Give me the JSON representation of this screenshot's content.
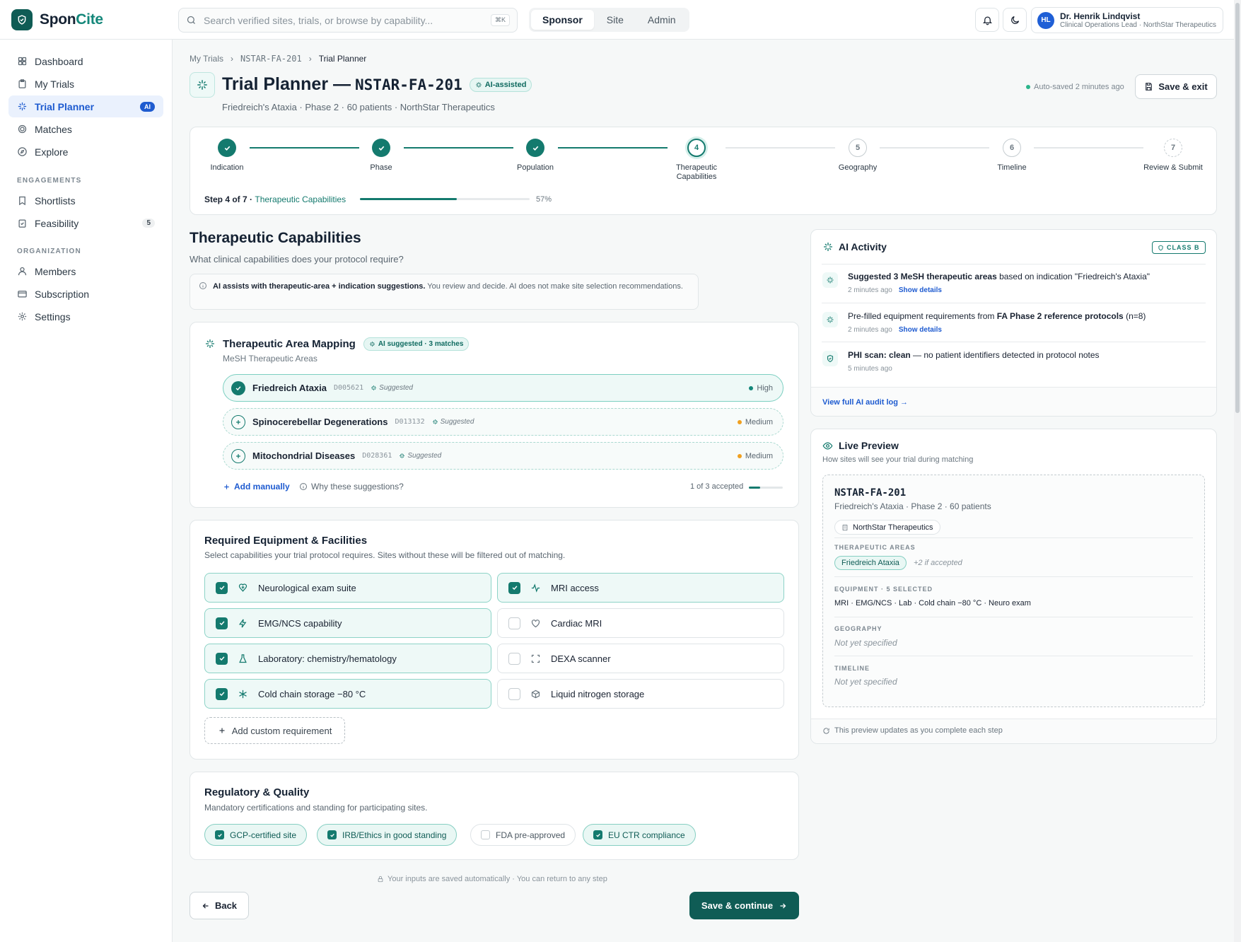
{
  "app": {
    "name_a": "Spon",
    "name_b": "Cite"
  },
  "search": {
    "placeholder": "Search verified sites, trials, or browse by capability...",
    "shortcut": "⌘K"
  },
  "roles": [
    "Sponsor",
    "Site",
    "Admin"
  ],
  "user": {
    "initials": "HL",
    "name": "Dr. Henrik Lindqvist",
    "role": "Clinical Operations Lead · NorthStar Therapeutics"
  },
  "sidebar": {
    "main": [
      {
        "label": "Dashboard",
        "icon": "grid-icon"
      },
      {
        "label": "My Trials",
        "icon": "clipboard-icon"
      },
      {
        "label": "Trial Planner",
        "icon": "sparkle-icon",
        "badge": "AI"
      },
      {
        "label": "Matches",
        "icon": "target-icon"
      },
      {
        "label": "Explore",
        "icon": "compass-icon"
      }
    ],
    "engagements_title": "ENGAGEMENTS",
    "engagements": [
      {
        "label": "Shortlists",
        "icon": "bookmark-icon"
      },
      {
        "label": "Feasibility",
        "icon": "clipboard-check-icon",
        "count": "5"
      }
    ],
    "organization_title": "ORGANIZATION",
    "organization": [
      {
        "label": "Members",
        "icon": "users-icon"
      },
      {
        "label": "Subscription",
        "icon": "card-icon"
      },
      {
        "label": "Settings",
        "icon": "gear-icon"
      }
    ]
  },
  "breadcrumb": [
    "My Trials",
    "NSTAR-FA-201",
    "Trial Planner"
  ],
  "header": {
    "title": "Trial Planner —",
    "trial_id": "NSTAR-FA-201",
    "ai_badge": "AI-assisted",
    "subtitle": "Friedreich's Ataxia · Phase 2 · 60 patients · NorthStar Therapeutics",
    "autosave": "Auto-saved 2 minutes ago",
    "save_exit": "Save & exit"
  },
  "stepper": {
    "steps": [
      {
        "n": "1",
        "label": "Indication",
        "state": "done"
      },
      {
        "n": "2",
        "label": "Phase",
        "state": "done"
      },
      {
        "n": "3",
        "label": "Population",
        "state": "done"
      },
      {
        "n": "4",
        "label": "Therapeutic Capabilities",
        "state": "current"
      },
      {
        "n": "5",
        "label": "Geography",
        "state": "todo"
      },
      {
        "n": "6",
        "label": "Timeline",
        "state": "todo"
      },
      {
        "n": "7",
        "label": "Review & Submit",
        "state": "final"
      }
    ],
    "step_text": "Step 4 of 7 ·",
    "step_name": "Therapeutic Capabilities",
    "progress": 57,
    "progress_label": "57%"
  },
  "section": {
    "title": "Therapeutic Capabilities",
    "subtitle": "What clinical capabilities does your protocol require?",
    "info_bold": "AI assists with therapeutic-area + indication suggestions.",
    "info_rest": " You review and decide. AI does not make site selection recommendations."
  },
  "ta": {
    "title": "Therapeutic Area Mapping",
    "badge": "AI suggested · 3 matches",
    "subtitle": "MeSH Therapeutic Areas",
    "rows": [
      {
        "name": "Friedreich Ataxia",
        "code": "D005621",
        "tag": "Suggested",
        "confidence": "High",
        "accepted": true
      },
      {
        "name": "Spinocerebellar Degenerations",
        "code": "D013132",
        "tag": "Suggested",
        "confidence": "Medium",
        "accepted": false
      },
      {
        "name": "Mitochondrial Diseases",
        "code": "D028361",
        "tag": "Suggested",
        "confidence": "Medium",
        "accepted": false
      }
    ],
    "add_manually": "Add manually",
    "why": "Why these suggestions?",
    "accepted_text": "1 of 3 accepted",
    "accepted_fraction": 0.333
  },
  "equipment": {
    "title": "Required Equipment & Facilities",
    "subtitle": "Select capabilities your trial protocol requires. Sites without these will be filtered out of matching.",
    "items": [
      {
        "label": "Neurological exam suite",
        "icon": "brain-icon",
        "checked": true
      },
      {
        "label": "MRI access",
        "icon": "pulse-icon",
        "checked": true
      },
      {
        "label": "EMG/NCS capability",
        "icon": "bolt-icon",
        "checked": true
      },
      {
        "label": "Cardiac MRI",
        "icon": "heart-icon",
        "checked": false
      },
      {
        "label": "Laboratory: chemistry/hematology",
        "icon": "flask-icon",
        "checked": true
      },
      {
        "label": "DEXA scanner",
        "icon": "scan-icon",
        "checked": false
      },
      {
        "label": "Cold chain storage −80 °C",
        "icon": "snowflake-icon",
        "checked": true
      },
      {
        "label": "Liquid nitrogen storage",
        "icon": "container-icon",
        "checked": false
      }
    ],
    "add_custom": "Add custom requirement"
  },
  "regulatory": {
    "title": "Regulatory & Quality",
    "subtitle": "Mandatory certifications and standing for participating sites.",
    "items": [
      {
        "label": "GCP-certified site",
        "checked": true
      },
      {
        "label": "IRB/Ethics in good standing",
        "checked": true
      },
      {
        "label": "FDA pre-approved",
        "checked": false
      },
      {
        "label": "EU CTR compliance",
        "checked": true
      }
    ]
  },
  "footer": {
    "note": "Your inputs are saved automatically · You can return to any step",
    "back": "Back",
    "continue": "Save & continue"
  },
  "ai_activity": {
    "title": "AI Activity",
    "class_badge": "CLASS B",
    "items": [
      {
        "bold": "Suggested 3 MeSH therapeutic areas",
        "rest": " based on indication \"Friedreich's Ataxia\"",
        "time": "2 minutes ago",
        "link": "Show details"
      },
      {
        "pre": "Pre-filled equipment requirements from ",
        "bold": "FA Phase 2 reference protocols",
        "rest": " (n=8)",
        "time": "2 minutes ago",
        "link": "Show details"
      },
      {
        "bold": "PHI scan: clean",
        "rest": " — no patient identifiers detected in protocol notes",
        "time": "5 minutes ago"
      }
    ],
    "audit_link": "View full AI audit log →"
  },
  "preview": {
    "title": "Live Preview",
    "subtitle": "How sites will see your trial during matching",
    "trial_id": "NSTAR-FA-201",
    "trial_desc": "Friedreich's Ataxia · Phase 2 · 60 patients",
    "sponsor": "NorthStar Therapeutics",
    "ta_label": "THERAPEUTIC AREAS",
    "ta_chip": "Friedreich Ataxia",
    "ta_more": "+2 if accepted",
    "eq_label": "EQUIPMENT · 5 SELECTED",
    "eq_value": "MRI · EMG/NCS · Lab · Cold chain −80 °C · Neuro exam",
    "geo_label": "GEOGRAPHY",
    "geo_value": "Not yet specified",
    "time_label": "TIMELINE",
    "time_value": "Not yet specified",
    "footer": "This preview updates as you complete each step"
  },
  "colors": {
    "brand": "#0f5c55",
    "accent": "#147a6e",
    "link": "#1e5bd0",
    "high": "#14877a",
    "medium": "#f0a020"
  }
}
